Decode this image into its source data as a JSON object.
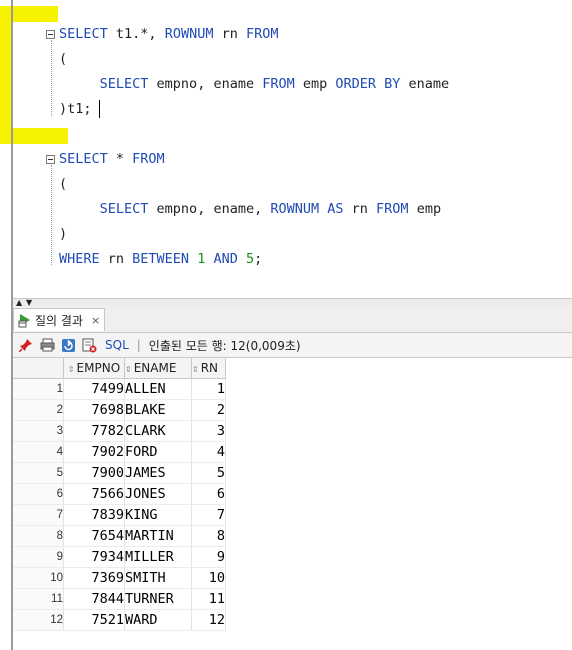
{
  "editor": {
    "statement1": {
      "select_kw": "SELECT",
      "select_rest": " t1.*, ",
      "rownum_kw": "ROWNUM",
      "rn_alias": " rn ",
      "from_kw": "FROM",
      "open_paren": "(",
      "inner_select_kw": "SELECT",
      "inner_cols": " empno, ename ",
      "inner_from_kw": "FROM",
      "inner_table": " emp ",
      "order_kw": "ORDER",
      "by_kw": "BY",
      "order_col": " ename",
      "close": ")t1;"
    },
    "statement2": {
      "select_kw": "SELECT",
      "star": " * ",
      "from_kw": "FROM",
      "open_paren": "(",
      "inner_select_kw": "SELECT",
      "inner_cols": " empno, ename, ",
      "rownum_kw": "ROWNUM",
      "as_kw": "AS",
      "rn_alias": " rn ",
      "inner_from_kw": "FROM",
      "inner_table": " emp",
      "close_paren": ")",
      "where_kw": "WHERE",
      "rn_col": " rn ",
      "between_kw": "BETWEEN",
      "lower": "1",
      "and_kw": "AND",
      "upper": "5",
      "semicolon": ";"
    }
  },
  "results": {
    "tab_label": "질의 결과",
    "tab_close": "×",
    "toolbar": {
      "sql_label": "SQL",
      "separator": "|",
      "status": "인출된 모든 행: 12(0,009초)"
    },
    "columns": [
      "EMPNO",
      "ENAME",
      "RN"
    ],
    "rows": [
      {
        "idx": "1",
        "empno": "7499",
        "ename": "ALLEN",
        "rn": "1"
      },
      {
        "idx": "2",
        "empno": "7698",
        "ename": "BLAKE",
        "rn": "2"
      },
      {
        "idx": "3",
        "empno": "7782",
        "ename": "CLARK",
        "rn": "3"
      },
      {
        "idx": "4",
        "empno": "7902",
        "ename": "FORD",
        "rn": "4"
      },
      {
        "idx": "5",
        "empno": "7900",
        "ename": "JAMES",
        "rn": "5"
      },
      {
        "idx": "6",
        "empno": "7566",
        "ename": "JONES",
        "rn": "6"
      },
      {
        "idx": "7",
        "empno": "7839",
        "ename": "KING",
        "rn": "7"
      },
      {
        "idx": "8",
        "empno": "7654",
        "ename": "MARTIN",
        "rn": "8"
      },
      {
        "idx": "9",
        "empno": "7934",
        "ename": "MILLER",
        "rn": "9"
      },
      {
        "idx": "10",
        "empno": "7369",
        "ename": "SMITH",
        "rn": "10"
      },
      {
        "idx": "11",
        "empno": "7844",
        "ename": "TURNER",
        "rn": "11"
      },
      {
        "idx": "12",
        "empno": "7521",
        "ename": "WARD",
        "rn": "12"
      }
    ]
  },
  "colors": {
    "keyword": "#1f4bb4",
    "number": "#169216",
    "highlight": "#f6f200"
  }
}
